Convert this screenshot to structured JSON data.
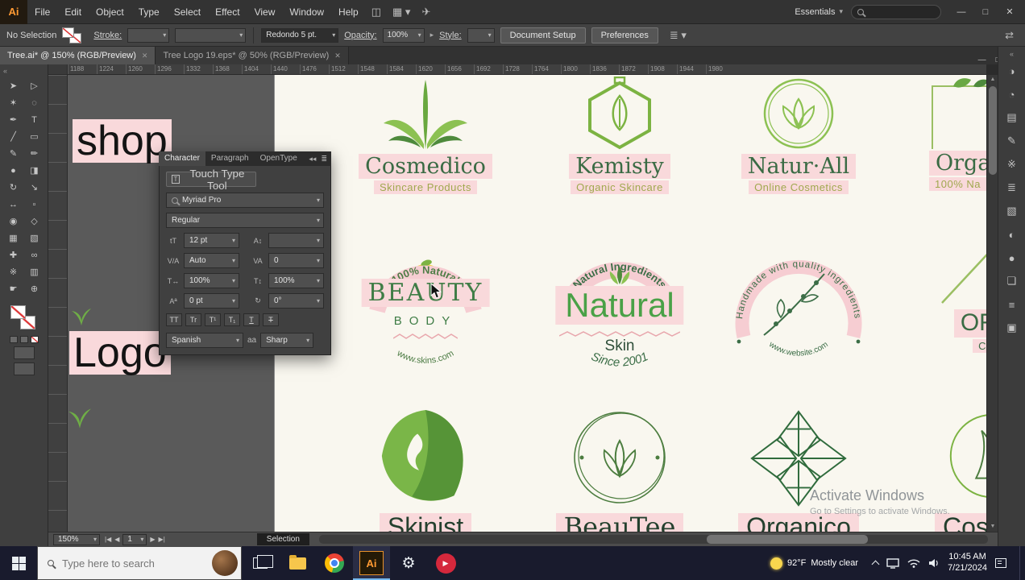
{
  "colors": {
    "accent_orange": "#ff9a33",
    "highlight_pink": "#f9d9db",
    "logo_green_dark": "#3a6b44",
    "logo_green_light": "#8cc152",
    "canvas_cream": "#f9f7ef",
    "taskbar_navy": "#191b2d"
  },
  "menubar": {
    "app_badge": "Ai",
    "items": [
      "File",
      "Edit",
      "Object",
      "Type",
      "Select",
      "Effect",
      "View",
      "Window",
      "Help"
    ],
    "workspace": "Essentials",
    "controls": {
      "minimize": "—",
      "maximize": "□",
      "close": "✕"
    }
  },
  "controlbar": {
    "selection_status": "No Selection",
    "stroke_label": "Stroke:",
    "brush_preset": "Redondo 5 pt.",
    "opacity_label": "Opacity:",
    "opacity_value": "100%",
    "style_label": "Style:",
    "document_setup": "Document Setup",
    "preferences": "Preferences"
  },
  "tabs": [
    {
      "title": "Tree.ai* @ 150% (RGB/Preview)",
      "close": "✕"
    },
    {
      "title": "Tree Logo 19.eps* @ 50% (RGB/Preview)",
      "close": "✕"
    }
  ],
  "ruler": {
    "ticks": [
      "1188",
      "1224",
      "1260",
      "1296",
      "1332",
      "1368",
      "1404",
      "1440",
      "1476",
      "1512",
      "1548",
      "1584",
      "1620",
      "1656",
      "1692",
      "1728",
      "1764",
      "1800",
      "1836",
      "1872",
      "1908",
      "1944",
      "1980"
    ]
  },
  "toolbar": {
    "tools": [
      {
        "name": "selection-tool",
        "glyph": "➤"
      },
      {
        "name": "direct-selection-tool",
        "glyph": "▷"
      },
      {
        "name": "magic-wand-tool",
        "glyph": "✶"
      },
      {
        "name": "lasso-tool",
        "glyph": "◌"
      },
      {
        "name": "pen-tool",
        "glyph": "✒"
      },
      {
        "name": "type-tool",
        "glyph": "T"
      },
      {
        "name": "line-segment-tool",
        "glyph": "╱"
      },
      {
        "name": "rectangle-tool",
        "glyph": "▭"
      },
      {
        "name": "paintbrush-tool",
        "glyph": "✎"
      },
      {
        "name": "pencil-tool",
        "glyph": "✏"
      },
      {
        "name": "blob-brush-tool",
        "glyph": "●"
      },
      {
        "name": "eraser-tool",
        "glyph": "◨"
      },
      {
        "name": "rotate-tool",
        "glyph": "↻"
      },
      {
        "name": "scale-tool",
        "glyph": "↘"
      },
      {
        "name": "width-tool",
        "glyph": "↔"
      },
      {
        "name": "free-transform-tool",
        "glyph": "▫"
      },
      {
        "name": "shape-builder-tool",
        "glyph": "◉"
      },
      {
        "name": "perspective-grid-tool",
        "glyph": "◇"
      },
      {
        "name": "mesh-tool",
        "glyph": "▦"
      },
      {
        "name": "gradient-tool",
        "glyph": "▧"
      },
      {
        "name": "eyedropper-tool",
        "glyph": "✚"
      },
      {
        "name": "blend-tool",
        "glyph": "∞"
      },
      {
        "name": "symbol-sprayer-tool",
        "glyph": "※"
      },
      {
        "name": "column-graph-tool",
        "glyph": "▥"
      },
      {
        "name": "hand-tool",
        "glyph": "☛"
      },
      {
        "name": "zoom-tool",
        "glyph": "⊕"
      }
    ]
  },
  "character_panel": {
    "tabs": [
      "Character",
      "Paragraph",
      "OpenType"
    ],
    "touch_type_label": "Touch Type Tool",
    "font_family": "Myriad Pro",
    "font_style": "Regular",
    "icons": {
      "size": "tT",
      "leading": "A↕",
      "kerning": "V/A",
      "tracking": "VA",
      "h_scale": "T↔",
      "v_scale": "T↕",
      "baseline": "Aª",
      "rotation": "↻"
    },
    "fields": {
      "size": "12 pt",
      "leading": "",
      "kerning": "Auto",
      "tracking": "0",
      "h_scale": "100%",
      "v_scale": "100%",
      "baseline": "0 pt",
      "rotation": "0°"
    },
    "toggles": [
      "TT",
      "Tr",
      "T¹",
      "T₁",
      "T",
      "T"
    ],
    "language": "Spanish",
    "aa_label": "aa",
    "antialias": "Sharp"
  },
  "pasteboard": {
    "text_shop": "shop",
    "text_logo": "Logo"
  },
  "canvas": {
    "row1": [
      {
        "title": "Cosmedico",
        "subtitle": "Skincare Products"
      },
      {
        "title": "Kemisty",
        "subtitle": "Organic Skincare"
      },
      {
        "title": "Natur·All",
        "subtitle": "Online Cosmetics"
      },
      {
        "title": "Orga",
        "subtitle": "100% Na"
      }
    ],
    "row2": {
      "badge1": {
        "arc_top": "100% Natural",
        "title": "BEAUTY",
        "subtitle": "BODY",
        "arc_bottom": "www.skins.com"
      },
      "badge2": {
        "arc_top": "Natural Ingredients",
        "title": "Natural",
        "subtitle": "Skin",
        "arc_bottom": "Since 2001"
      },
      "badge3": {
        "circle_text": "Handmade with quality ingredients",
        "arc_bottom": "www.website.com"
      },
      "badge4": {
        "title": "ORGA",
        "subtitle": "Cosme"
      }
    },
    "row3": [
      {
        "title": "Skinist"
      },
      {
        "title": "BeauTee"
      },
      {
        "title": "Organico"
      },
      {
        "title": "Cosm"
      }
    ],
    "watermark": {
      "line1": "Activate Windows",
      "line2": "Go to Settings to activate Windows."
    }
  },
  "statusbar": {
    "zoom": "150%",
    "artboard": "1",
    "tool_hint": "Selection",
    "nav_first": "|◀",
    "nav_prev": "◀",
    "nav_next": "▶",
    "nav_last": "▶|"
  },
  "rightrail": {
    "icons": [
      {
        "name": "color-panel-icon",
        "glyph": "◑"
      },
      {
        "name": "color-guide-icon",
        "glyph": "◔"
      },
      {
        "name": "swatches-panel-icon",
        "glyph": "▤"
      },
      {
        "name": "brushes-panel-icon",
        "glyph": "✎"
      },
      {
        "name": "symbols-panel-icon",
        "glyph": "※"
      },
      {
        "name": "stroke-panel-icon",
        "glyph": "≣"
      },
      {
        "name": "gradient-panel-icon",
        "glyph": "▧"
      },
      {
        "name": "transparency-panel-icon",
        "glyph": "◐"
      },
      {
        "name": "appearance-panel-icon",
        "glyph": "●"
      },
      {
        "name": "graphic-styles-panel-icon",
        "glyph": "❏"
      },
      {
        "name": "layers-panel-icon",
        "glyph": "≡"
      },
      {
        "name": "artboards-panel-icon",
        "glyph": "▣"
      }
    ]
  },
  "taskbar": {
    "search_placeholder": "Type here to search",
    "weather_temp": "92°F",
    "weather_desc": "Mostly clear",
    "time": "10:45 AM",
    "date": "7/21/2024"
  }
}
